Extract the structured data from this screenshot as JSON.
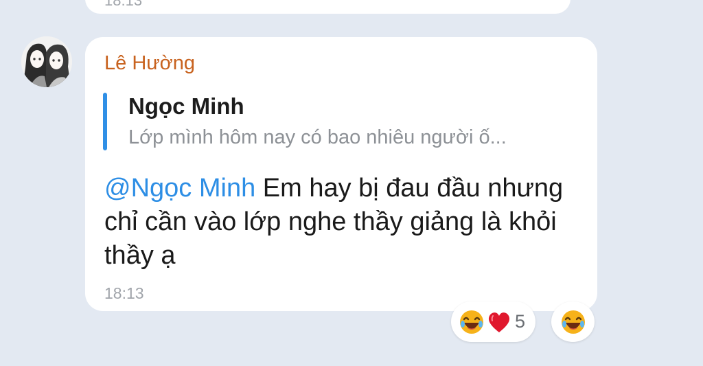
{
  "previous_message": {
    "time": "18:13"
  },
  "message": {
    "sender": "Lê Hường",
    "avatar_icon": "avatar-two-anime-girls",
    "reply": {
      "name": "Ngọc Minh",
      "text": "Lớp mình hôm nay có bao nhiêu người ố..."
    },
    "mention": "@Ngọc Minh",
    "text": " Em hay bị đau đầu nhưng chỉ cần vào lớp nghe thầy giảng là khỏi thầy ạ",
    "time": "18:13"
  },
  "reactions": {
    "icons": [
      "laughing-emoji-icon",
      "red-heart-icon"
    ],
    "count": "5"
  },
  "react_button": {
    "icon": "laughing-emoji-icon"
  },
  "colors": {
    "background": "#e3e9f2",
    "sender": "#c8621e",
    "accent": "#2f8fe6",
    "mention": "#2d8ee5",
    "heart": "#e0182e",
    "emoji": "#f6b21a"
  }
}
